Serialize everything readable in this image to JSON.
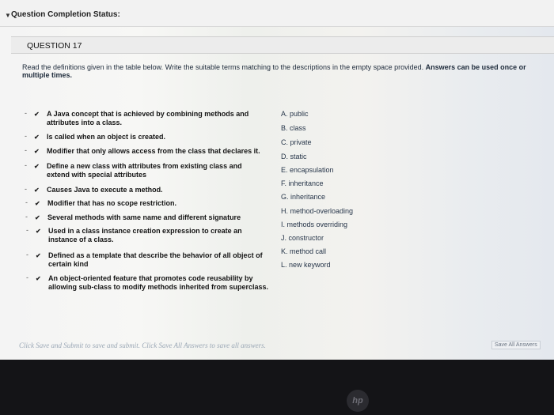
{
  "status": {
    "label": "Question Completion Status:"
  },
  "question": {
    "title": "QUESTION 17"
  },
  "instructions": {
    "text": "Read the definitions given in the table below. Write the suitable terms matching to the descriptions in the empty space provided.",
    "emphasis": "Answers can be used once or multiple times."
  },
  "rows": [
    {
      "line1": "A Java concept that is achieved by combining methods and",
      "line2": "attributes into a class."
    },
    {
      "line1": "Is called when an object is created.",
      "line2": ""
    },
    {
      "line1": "Modifier that only allows access from the class that declares it.",
      "line2": ""
    },
    {
      "line1": "Define a new class with attributes from existing class and",
      "line2": "extend with special attributes"
    },
    {
      "line1": "Causes Java to execute a method.",
      "line2": ""
    },
    {
      "line1": "Modifier that has no scope restriction.",
      "line2": ""
    },
    {
      "line1": "Several methods with same name and different signature",
      "line2": ""
    },
    {
      "line1": "Used in a class instance creation expression to create an",
      "line2": "instance of a class."
    },
    {
      "line1": "Defined as a template that describe the behavior of all object of",
      "line2": "certain kind"
    },
    {
      "line1": "An object-oriented feature that promotes code reusability by",
      "line2": "allowing sub-class to modify methods inherited from superclass."
    }
  ],
  "options": [
    "A. public",
    "B. class",
    "C. private",
    "D. static",
    "E. encapsulation",
    "F. inheritance",
    "G. inheritance",
    "H. method-overloading",
    "I. methods overriding",
    "J. constructor",
    "K. method call",
    "L. new keyword"
  ],
  "footer": {
    "hint": "Click Save and Submit to save and submit. Click Save All Answers to save all answers.",
    "save_all": "Save All Answers"
  },
  "device": {
    "logo": "hp"
  }
}
